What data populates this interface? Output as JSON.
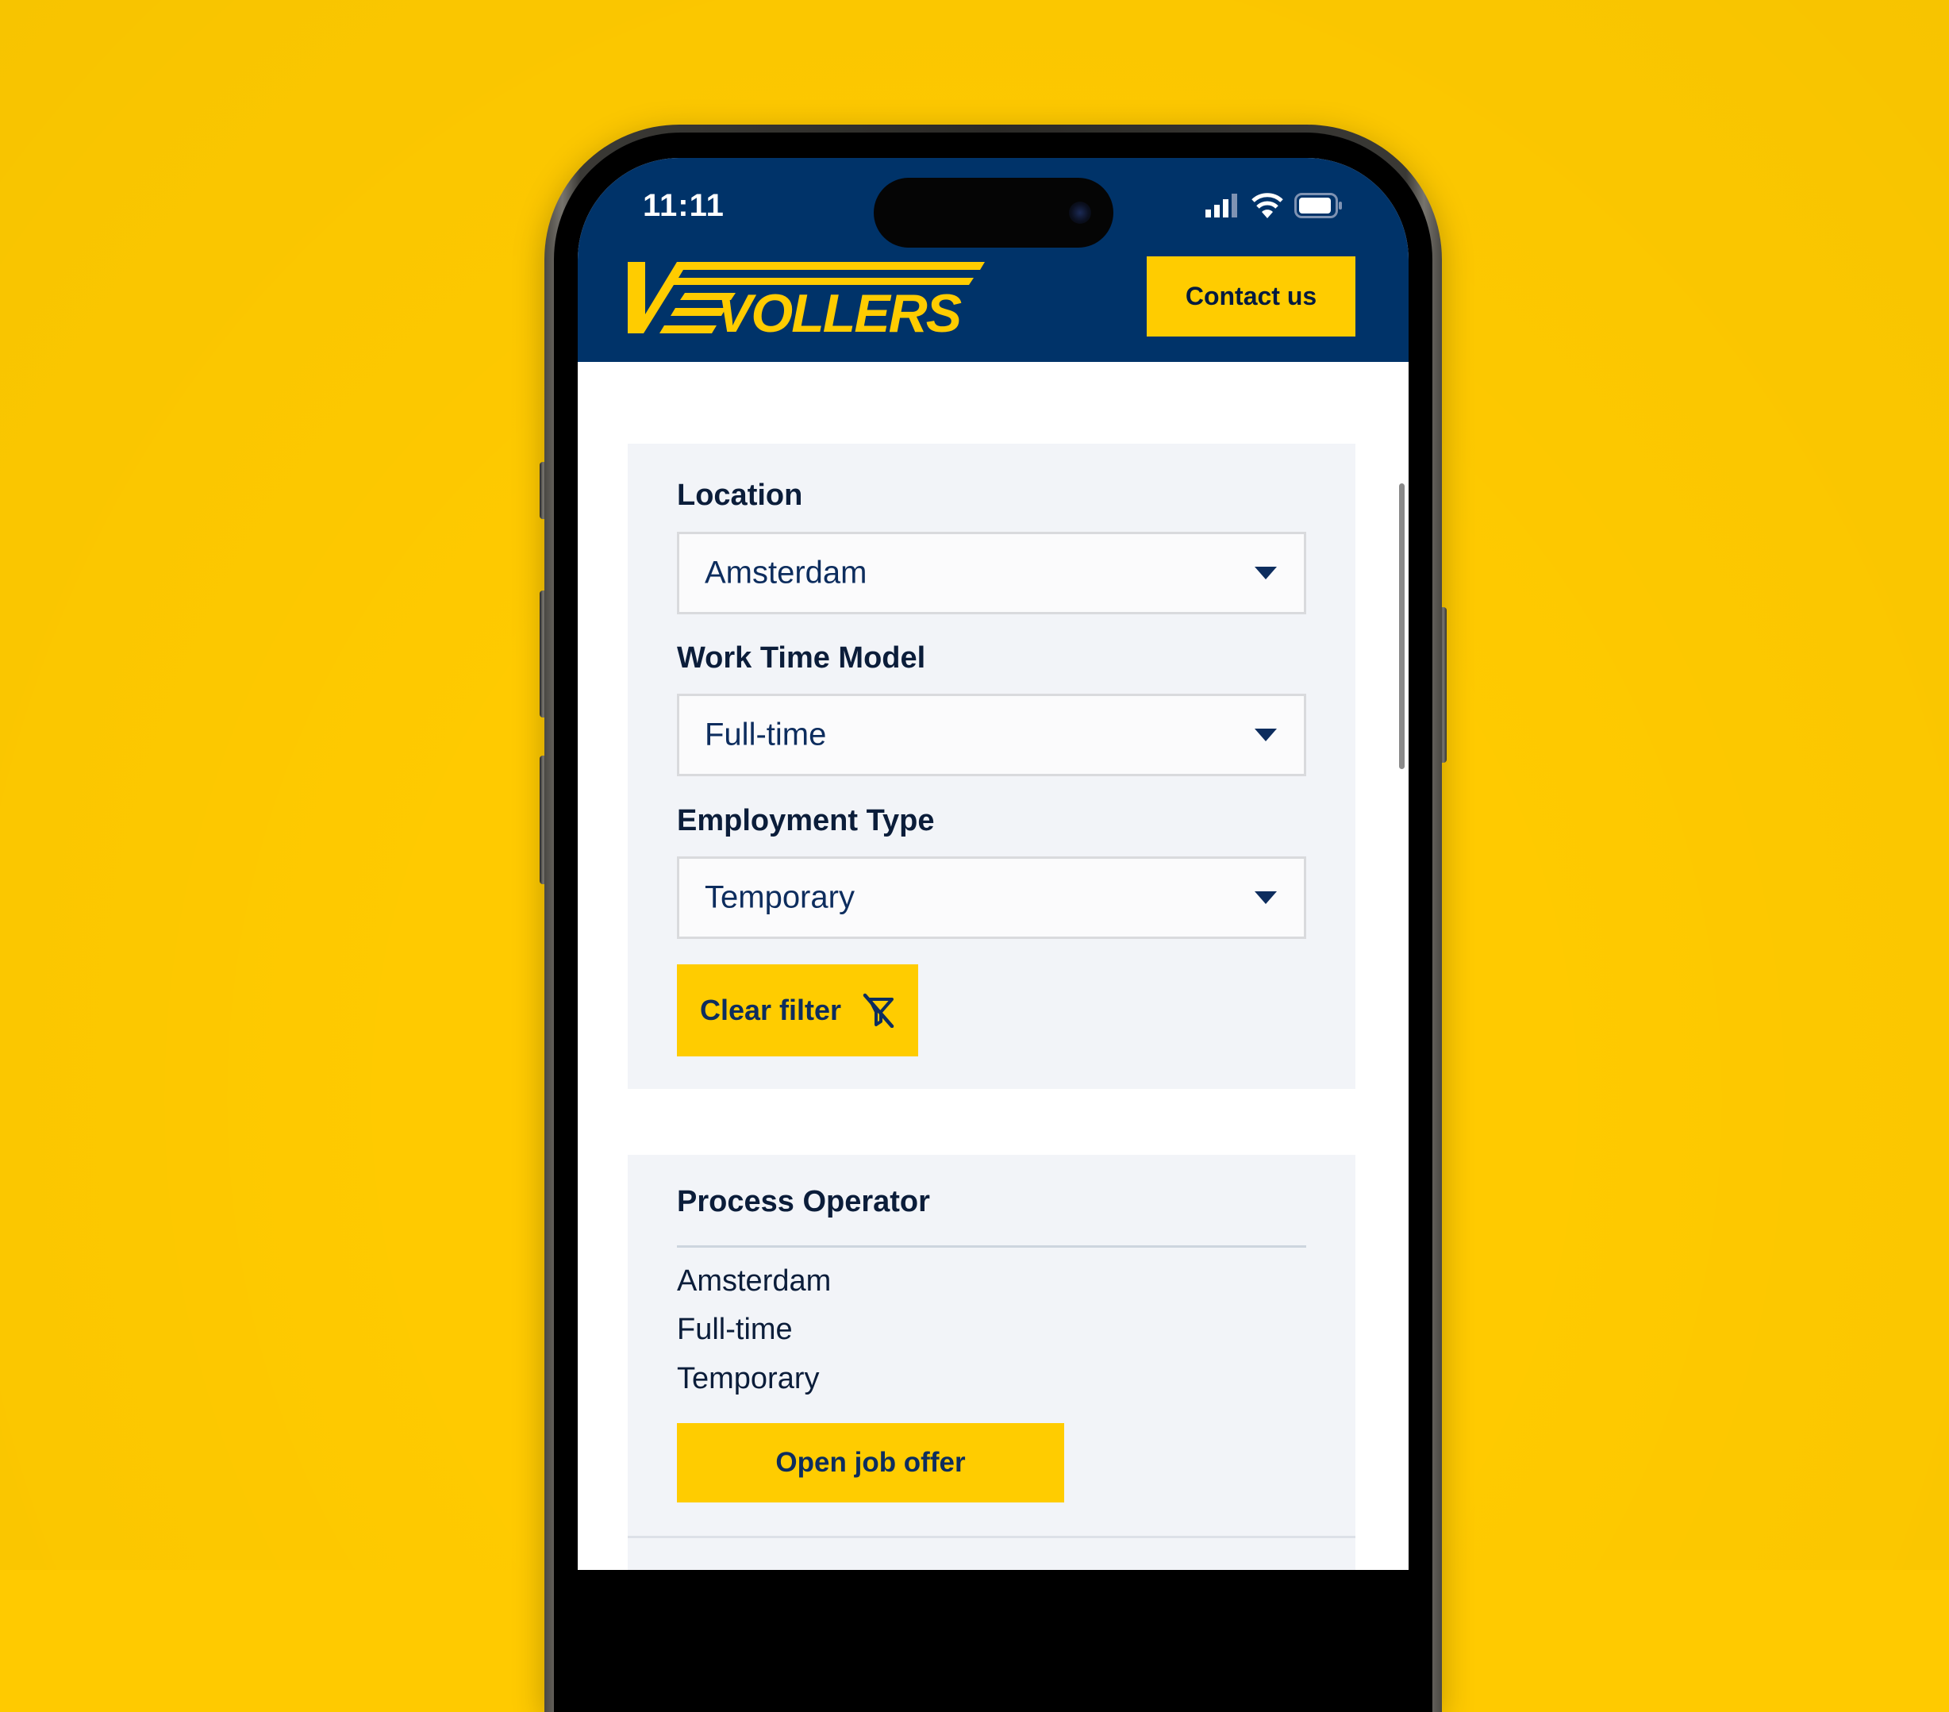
{
  "status_bar": {
    "time": "11:11",
    "icons": [
      "signal-icon",
      "wifi-icon",
      "battery-icon"
    ]
  },
  "header": {
    "brand": "VOLLERS",
    "contact_label": "Contact us"
  },
  "filters": [
    {
      "label": "Location",
      "value": "Amsterdam"
    },
    {
      "label": "Work Time Model",
      "value": "Full-time"
    },
    {
      "label": "Employment Type",
      "value": "Temporary"
    }
  ],
  "clear_filter": {
    "label": "Clear filter",
    "icon": "filter-off-icon"
  },
  "jobs": [
    {
      "title": "Process Operator",
      "location": "Amsterdam",
      "work_time": "Full-time",
      "employment": "Temporary",
      "button_label": "Open job offer"
    }
  ],
  "colors": {
    "background": "#FFCA00",
    "brand_navy": "#003369",
    "accent_yellow": "#FFCC00",
    "card_bg": "#F2F4F8",
    "text_dark": "#0b1d3a"
  }
}
